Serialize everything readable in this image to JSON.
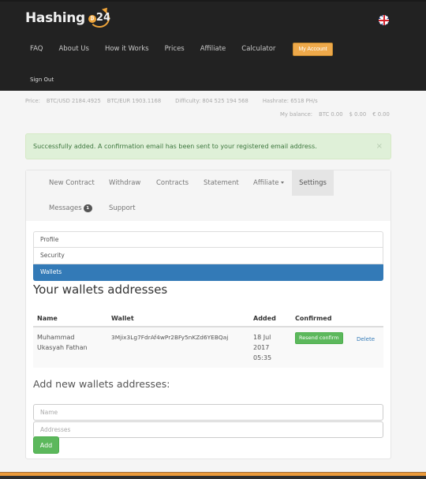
{
  "header": {
    "logo_text": "Hashing",
    "logo_number": "24",
    "logo_coin_glyph": "₿",
    "language_flag": "uk-flag",
    "nav": [
      {
        "label": "FAQ"
      },
      {
        "label": "About Us"
      },
      {
        "label": "How it Works"
      },
      {
        "label": "Prices"
      },
      {
        "label": "Affiliate"
      },
      {
        "label": "Calculator"
      }
    ],
    "my_account_label": "My Account",
    "sign_out_label": "Sign Out"
  },
  "info": {
    "price_label": "Price:",
    "btc_usd": "BTC/USD 2184.4925",
    "btc_eur": "BTC/EUR 1903.1168",
    "difficulty": "Difficulty: 804 525 194 568",
    "hashrate": "Hashrate: 6518 PH/s",
    "balance_label": "My balance:",
    "balance_btc": "BTC 0.00",
    "balance_usd": "$ 0.00",
    "balance_eur": "€ 0.00"
  },
  "alert": {
    "message": "Successfully added. A confirmation email has been sent to your registered email address.",
    "close_glyph": "×"
  },
  "tabs": {
    "items": [
      {
        "label": "New Contract"
      },
      {
        "label": "Withdraw"
      },
      {
        "label": "Contracts"
      },
      {
        "label": "Statement"
      },
      {
        "label": "Affiliate"
      },
      {
        "label": "Settings"
      },
      {
        "label": "Messages"
      },
      {
        "label": "Support"
      }
    ],
    "active": "Settings",
    "messages_badge": "1"
  },
  "settings_menu": {
    "items": [
      {
        "label": "Profile"
      },
      {
        "label": "Security"
      },
      {
        "label": "Wallets"
      }
    ],
    "active": "Wallets"
  },
  "wallets": {
    "heading": "Your wallets addresses",
    "columns": [
      "Name",
      "Wallet",
      "Added",
      "Confirmed",
      ""
    ],
    "rows": [
      {
        "name_line1": "Muhammad",
        "name_line2": "Ukasyah Fathan",
        "wallet": "3Mjix3Lg7FdrAf4wPr2BFy5nKZd6YEBQaj",
        "added_line1": "18 Jul",
        "added_line2": "2017",
        "added_line3": "05:35",
        "confirm_button": "Resend confirm",
        "delete_label": "Delete"
      }
    ]
  },
  "add_form": {
    "heading": "Add new wallets addresses:",
    "name_placeholder": "Name",
    "name_value": "",
    "address_placeholder": "Addresses",
    "address_value": "",
    "submit_label": "Add"
  },
  "colors": {
    "header_bg": "#222222",
    "accent_orange": "#eea94a",
    "primary_blue": "#337ab7",
    "success_green": "#5cb85c",
    "alert_bg": "#dff0d8"
  }
}
